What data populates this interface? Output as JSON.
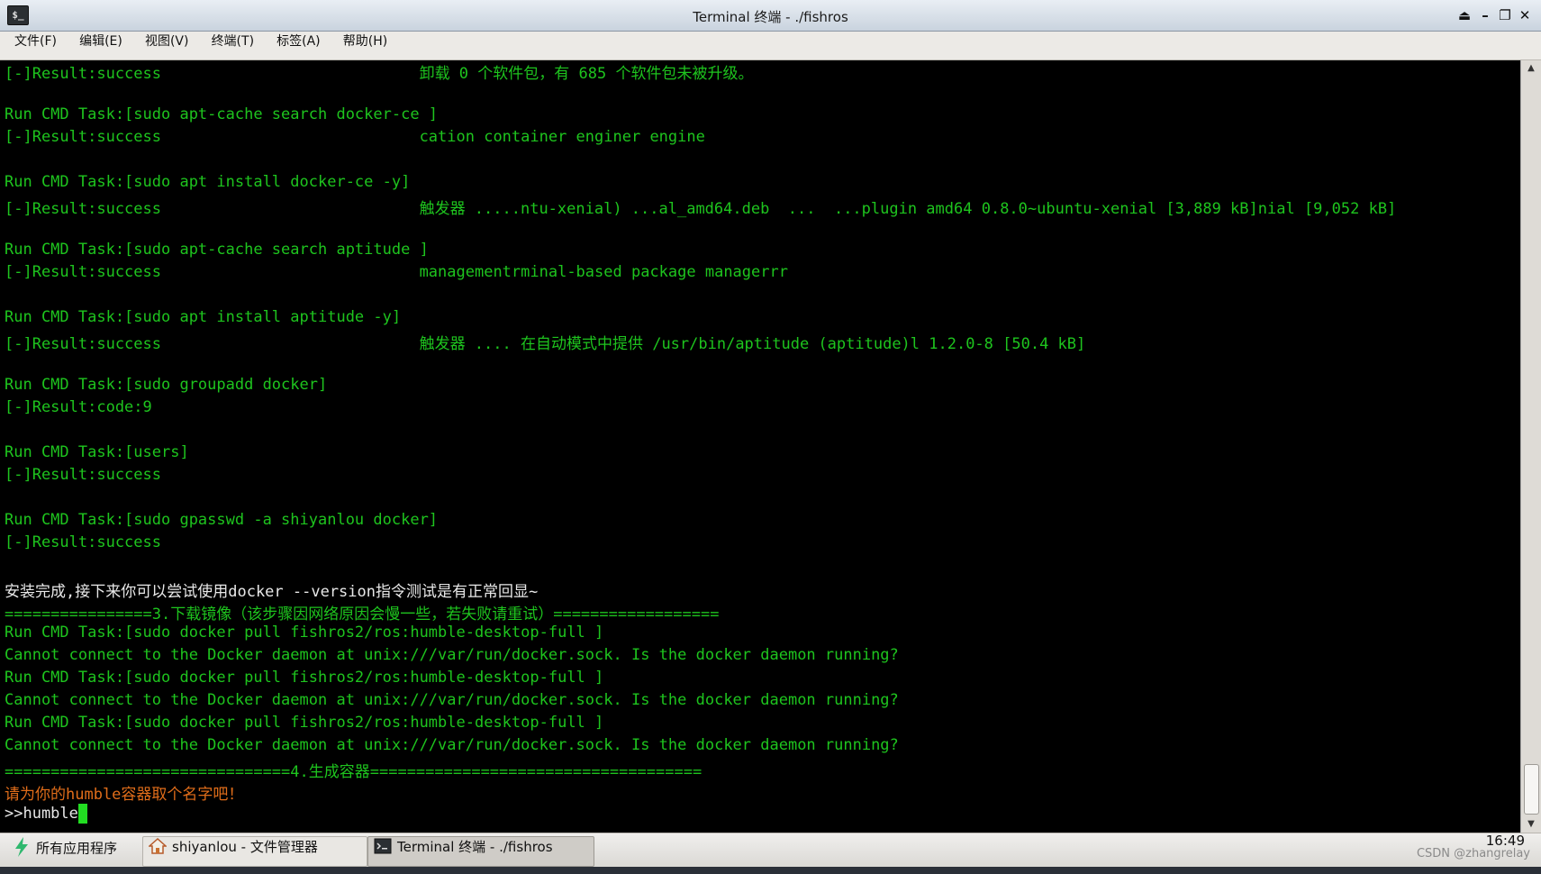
{
  "window": {
    "title": "Terminal 终端 - ./fishros",
    "app_icon": "terminal-icon",
    "controls": [
      "eject-icon",
      "minimize-icon",
      "restore-icon",
      "close-icon"
    ],
    "control_glyphs": {
      "eject": "⏏",
      "minimize": "–",
      "restore": "❐",
      "close": "✕"
    }
  },
  "menu": {
    "items": [
      "文件(F)",
      "编辑(E)",
      "视图(V)",
      "终端(T)",
      "标签(A)",
      "帮助(H)"
    ]
  },
  "terminal": {
    "colors": {
      "green": "#1ec41e",
      "white": "#e8e8e8",
      "orange": "#e06d1a",
      "background": "#000000",
      "cursor": "#22dd22"
    },
    "lines": [
      {
        "text": "[-]Result:success                            卸载 0 个软件包，有 685 个软件包未被升级。",
        "color": "green"
      },
      {
        "text": "",
        "color": "green"
      },
      {
        "text": "Run CMD Task:[sudo apt-cache search docker-ce ]",
        "color": "green"
      },
      {
        "text": "[-]Result:success                            cation container enginer engine",
        "color": "green"
      },
      {
        "text": "",
        "color": "green"
      },
      {
        "text": "Run CMD Task:[sudo apt install docker-ce -y]",
        "color": "green"
      },
      {
        "text": "[-]Result:success                            触发器 .....ntu-xenial) ...al_amd64.deb  ...  ...plugin amd64 0.8.0~ubuntu-xenial [3,889 kB]nial [9,052 kB]",
        "color": "green"
      },
      {
        "text": "",
        "color": "green"
      },
      {
        "text": "Run CMD Task:[sudo apt-cache search aptitude ]",
        "color": "green"
      },
      {
        "text": "[-]Result:success                            managementrminal-based package managerrr",
        "color": "green"
      },
      {
        "text": "",
        "color": "green"
      },
      {
        "text": "Run CMD Task:[sudo apt install aptitude -y]",
        "color": "green"
      },
      {
        "text": "[-]Result:success                            触发器 .... 在自动模式中提供 /usr/bin/aptitude (aptitude)l 1.2.0-8 [50.4 kB]",
        "color": "green"
      },
      {
        "text": "",
        "color": "green"
      },
      {
        "text": "Run CMD Task:[sudo groupadd docker]",
        "color": "green"
      },
      {
        "text": "[-]Result:code:9",
        "color": "green"
      },
      {
        "text": "",
        "color": "green"
      },
      {
        "text": "Run CMD Task:[users]",
        "color": "green"
      },
      {
        "text": "[-]Result:success",
        "color": "green"
      },
      {
        "text": "",
        "color": "green"
      },
      {
        "text": "Run CMD Task:[sudo gpasswd -a shiyanlou docker]",
        "color": "green"
      },
      {
        "text": "[-]Result:success",
        "color": "green"
      },
      {
        "text": "",
        "color": "green"
      },
      {
        "text": "安装完成,接下来你可以尝试使用docker --version指令测试是有正常回显~",
        "color": "white"
      },
      {
        "text": "================3.下载镜像（该步骤因网络原因会慢一些，若失败请重试）==================",
        "color": "green"
      },
      {
        "text": "Run CMD Task:[sudo docker pull fishros2/ros:humble-desktop-full ]",
        "color": "green"
      },
      {
        "text": "Cannot connect to the Docker daemon at unix:///var/run/docker.sock. Is the docker daemon running?",
        "color": "green"
      },
      {
        "text": "Run CMD Task:[sudo docker pull fishros2/ros:humble-desktop-full ]",
        "color": "green"
      },
      {
        "text": "Cannot connect to the Docker daemon at unix:///var/run/docker.sock. Is the docker daemon running?",
        "color": "green"
      },
      {
        "text": "Run CMD Task:[sudo docker pull fishros2/ros:humble-desktop-full ]",
        "color": "green"
      },
      {
        "text": "Cannot connect to the Docker daemon at unix:///var/run/docker.sock. Is the docker daemon running?",
        "color": "green"
      },
      {
        "text": "===============================4.生成容器====================================",
        "color": "green"
      },
      {
        "text": "请为你的humble容器取个名字吧！",
        "color": "orange"
      }
    ],
    "prompt": ">>humble"
  },
  "taskbar": {
    "start_label": "所有应用程序",
    "start_icon": "app-launcher-leaf-icon",
    "windows": [
      {
        "label": "shiyanlou - 文件管理器",
        "icon": "home-folder-icon",
        "active": false
      },
      {
        "label": "Terminal 终端 - ./fishros",
        "icon": "terminal-icon",
        "active": true
      }
    ],
    "clock": "16:49",
    "watermark": "CSDN @zhangrelay"
  }
}
